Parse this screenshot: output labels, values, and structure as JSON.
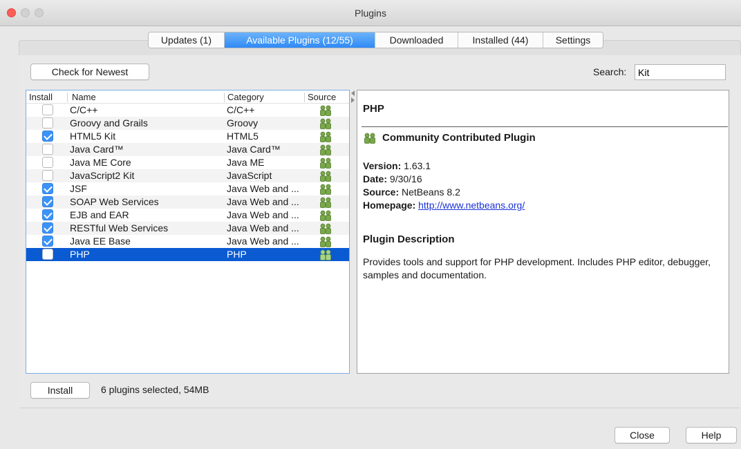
{
  "window": {
    "title": "Plugins"
  },
  "tabs": [
    {
      "label": "Updates (1)",
      "active": false
    },
    {
      "label": "Available Plugins (12/55)",
      "active": true
    },
    {
      "label": "Downloaded",
      "active": false
    },
    {
      "label": "Installed (44)",
      "active": false
    },
    {
      "label": "Settings",
      "active": false
    }
  ],
  "toolbar": {
    "check_label": "Check for Newest",
    "search_label": "Search:",
    "search_value": "Kit"
  },
  "table": {
    "headers": [
      "Install",
      "Name",
      "Category",
      "Source"
    ],
    "rows": [
      {
        "checked": false,
        "name": "C/C++",
        "category": "C/C++"
      },
      {
        "checked": false,
        "name": "Groovy and Grails",
        "category": "Groovy"
      },
      {
        "checked": true,
        "name": "HTML5 Kit",
        "category": "HTML5"
      },
      {
        "checked": false,
        "name": "Java Card™",
        "category": "Java Card™"
      },
      {
        "checked": false,
        "name": "Java ME Core",
        "category": "Java ME"
      },
      {
        "checked": false,
        "name": "JavaScript2 Kit",
        "category": "JavaScript"
      },
      {
        "checked": true,
        "name": "JSF",
        "category": "Java Web and ..."
      },
      {
        "checked": true,
        "name": "SOAP Web Services",
        "category": "Java Web and ..."
      },
      {
        "checked": true,
        "name": "EJB and EAR",
        "category": "Java Web and ..."
      },
      {
        "checked": true,
        "name": "RESTful Web Services",
        "category": "Java Web and ..."
      },
      {
        "checked": true,
        "name": "Java EE Base",
        "category": "Java Web and ..."
      },
      {
        "checked": false,
        "name": "PHP",
        "category": "PHP",
        "selected": true
      }
    ]
  },
  "detail": {
    "title": "PHP",
    "type": "Community Contributed Plugin",
    "version_label": "Version:",
    "version": "1.63.1",
    "date_label": "Date:",
    "date": "9/30/16",
    "source_label": "Source:",
    "source": "NetBeans 8.2",
    "homepage_label": "Homepage:",
    "homepage": "http://www.netbeans.org/",
    "description_title": "Plugin Description",
    "description": "Provides tools and support for PHP development. Includes PHP editor, debugger, samples and documentation."
  },
  "footer": {
    "install_label": "Install",
    "status": "6 plugins selected, 54MB"
  },
  "dialog_buttons": {
    "close": "Close",
    "help": "Help"
  },
  "colors": {
    "accent": "#2f8af5",
    "selection": "#0a5ad2",
    "community_icon": "#7aa84a"
  },
  "icons": {
    "source": "community-icon"
  }
}
